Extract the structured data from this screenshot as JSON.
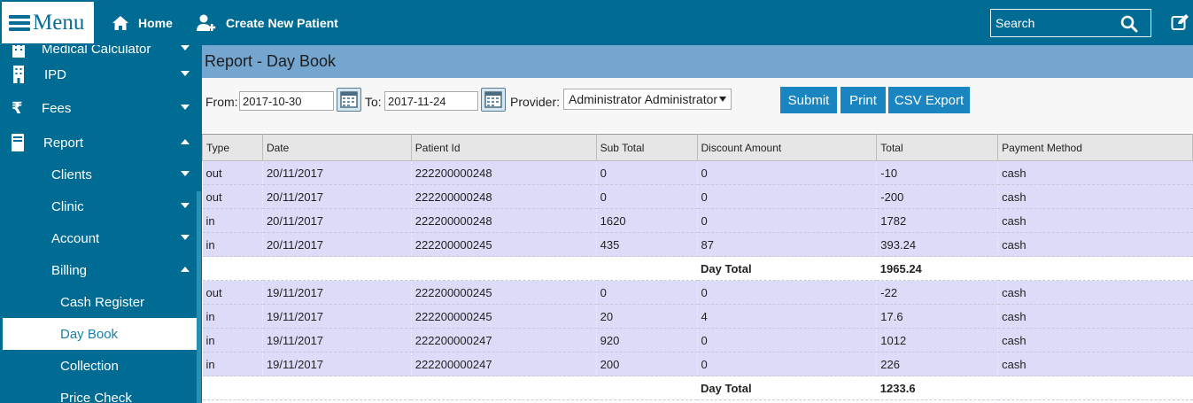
{
  "topbar": {
    "menu_label": "Menu",
    "home_label": "Home",
    "create_patient_label": "Create New Patient",
    "search_placeholder": "Search"
  },
  "sidebar": {
    "items": [
      {
        "label": "Medical Calculator",
        "icon": "building-icon"
      },
      {
        "label": "IPD",
        "icon": "building-icon"
      },
      {
        "label": "Fees",
        "icon": "rupee-icon"
      },
      {
        "label": "Report",
        "icon": "book-icon"
      },
      {
        "label": "Clients"
      },
      {
        "label": "Clinic"
      },
      {
        "label": "Account"
      },
      {
        "label": "Billing"
      },
      {
        "label": "Cash Register"
      },
      {
        "label": "Day Book"
      },
      {
        "label": "Collection"
      },
      {
        "label": "Price Check"
      }
    ]
  },
  "main": {
    "title": "Report - Day Book",
    "filters": {
      "from_label": "From:",
      "from_value": "2017-10-30",
      "to_label": "To:",
      "to_value": "2017-11-24",
      "provider_label": "Provider:",
      "provider_value": "Administrator Administrator"
    },
    "buttons": {
      "submit": "Submit",
      "print": "Print",
      "csv": "CSV Export"
    },
    "table": {
      "headers": [
        "Type",
        "Date",
        "Patient Id",
        "Sub Total",
        "Discount Amount",
        "Total",
        "Payment Method"
      ],
      "rows": [
        [
          "out",
          "20/11/2017",
          "222200000248",
          "0",
          "0",
          "-10",
          "cash"
        ],
        [
          "out",
          "20/11/2017",
          "222200000248",
          "0",
          "0",
          "-200",
          "cash"
        ],
        [
          "in",
          "20/11/2017",
          "222200000248",
          "1620",
          "0",
          "1782",
          "cash"
        ],
        [
          "in",
          "20/11/2017",
          "222200000245",
          "435",
          "87",
          "393.24",
          "cash"
        ],
        [
          "out",
          "19/11/2017",
          "222200000245",
          "0",
          "0",
          "-22",
          "cash"
        ],
        [
          "in",
          "19/11/2017",
          "222200000245",
          "20",
          "4",
          "17.6",
          "cash"
        ],
        [
          "in",
          "19/11/2017",
          "222200000247",
          "920",
          "0",
          "1012",
          "cash"
        ],
        [
          "in",
          "19/11/2017",
          "222200000247",
          "200",
          "0",
          "226",
          "cash"
        ]
      ],
      "day_total_label": "Day Total",
      "day_totals": [
        "1965.24",
        "1233.6"
      ]
    }
  },
  "colors": {
    "topbar_bg": "#006c93",
    "title_bar_bg": "#75a6cf",
    "button_bg": "#1b85c2",
    "row_bg": "#dcdcf8"
  }
}
